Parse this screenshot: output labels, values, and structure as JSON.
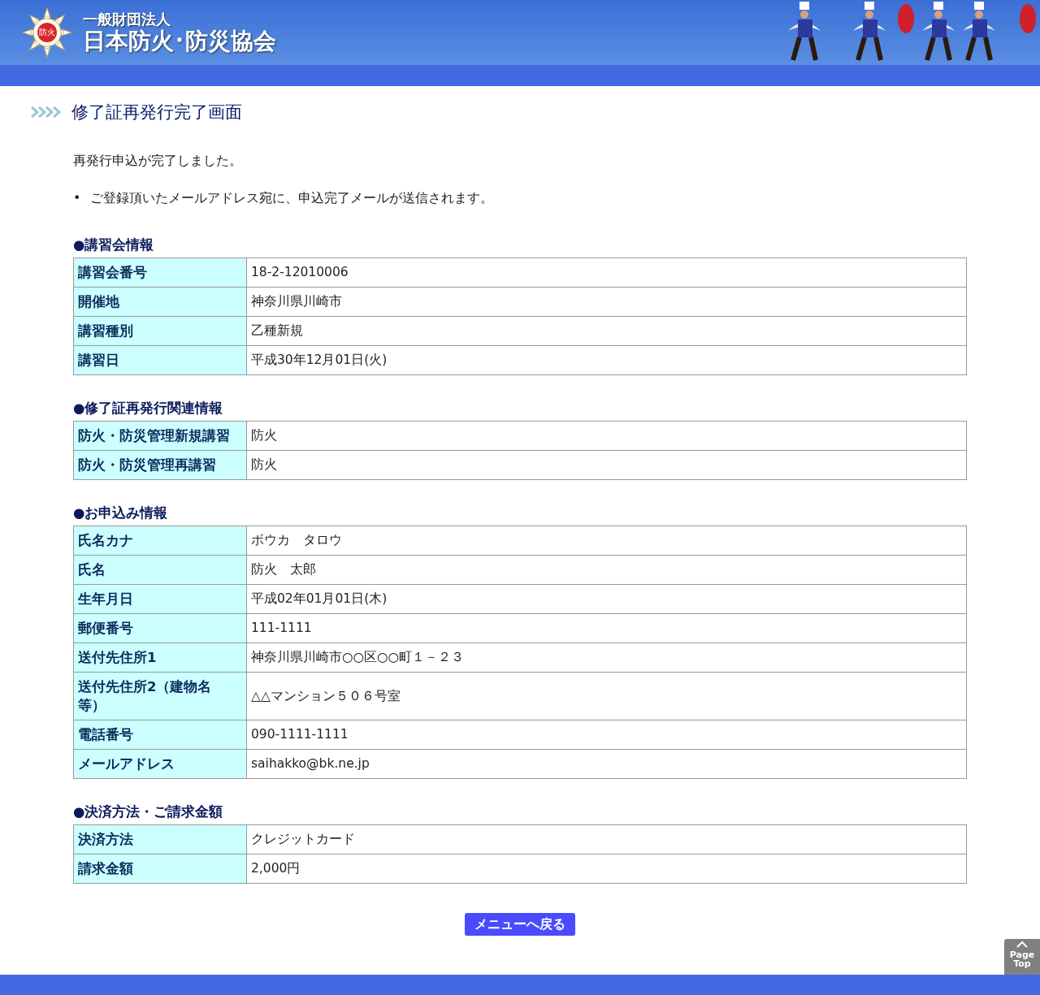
{
  "header": {
    "emblem_text": "防火",
    "org_type": "一般財団法人",
    "org_name": "日本防火･防災協会"
  },
  "page_title": "修了証再発行完了画面",
  "message": "再発行申込が完了しました。",
  "notes": [
    {
      "marker": "•",
      "text": "ご登録頂いたメールアドレス宛に、申込完了メールが送信されます。"
    }
  ],
  "sections": [
    {
      "heading": "●講習会情報",
      "rows": [
        {
          "label": "講習会番号",
          "value": "18-2-12010006"
        },
        {
          "label": "開催地",
          "value": "神奈川県川崎市"
        },
        {
          "label": "講習種別",
          "value": "乙種新規"
        },
        {
          "label": "講習日",
          "value": "平成30年12月01日(火)"
        }
      ]
    },
    {
      "heading": "●修了証再発行関連情報",
      "rows": [
        {
          "label": "防火・防災管理新規講習",
          "value": "防火"
        },
        {
          "label": "防火・防災管理再講習",
          "value": "防火"
        }
      ]
    },
    {
      "heading": "●お申込み情報",
      "rows": [
        {
          "label": "氏名カナ",
          "value": "ボウカ　タロウ"
        },
        {
          "label": "氏名",
          "value": "防火　太郎"
        },
        {
          "label": "生年月日",
          "value": "平成02年01月01日(木)"
        },
        {
          "label": "郵便番号",
          "value": "111-1111"
        },
        {
          "label": "送付先住所1",
          "value": "神奈川県川崎市○○区○○町１－２３"
        },
        {
          "label": "送付先住所2（建物名等）",
          "value": "△△マンション５０６号室"
        },
        {
          "label": "電話番号",
          "value": "090-1111-1111"
        },
        {
          "label": "メールアドレス",
          "value": "saihakko@bk.ne.jp"
        }
      ]
    },
    {
      "heading": "●決済方法・ご請求金額",
      "rows": [
        {
          "label": "決済方法",
          "value": "クレジットカード"
        },
        {
          "label": "請求金額",
          "value": "2,000円"
        }
      ]
    }
  ],
  "back_button": "メニューへ戻る",
  "page_top": [
    "Page",
    "Top"
  ]
}
